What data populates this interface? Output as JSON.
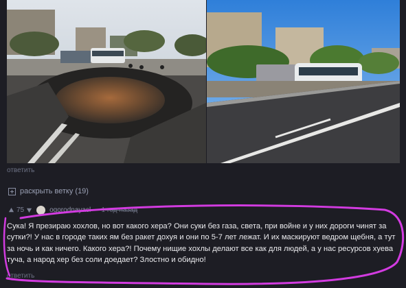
{
  "actions": {
    "reply_label": "ответить",
    "expand_thread_label": "раскрыть ветку (19)"
  },
  "comment": {
    "rating": "75",
    "username": "ogorodnayasl",
    "time": "1 год назад",
    "text": "Сука! Я презираю хохлов, но вот какого хера? Они суки без газа, света, при войне и у них дороги чинят за сутки?! У нас в городе таких ям без ракет дохуя и они по 5-7 лет лежат. И их маскируют ведром щебня, а тут за ночь и как ничего. Какого хера?! Почему нищие хохлы делают все как для людей, а у нас ресурсов хуева туча, а народ хер без соли доедает? Злостно и обидно!"
  },
  "icons": {
    "upvote": "arrow-up-icon",
    "downvote": "arrow-down-icon",
    "expand": "plus-square-icon"
  },
  "colors": {
    "background": "#1d1d24",
    "highlight_stroke": "#d23be0",
    "muted_text": "#6c7184"
  }
}
